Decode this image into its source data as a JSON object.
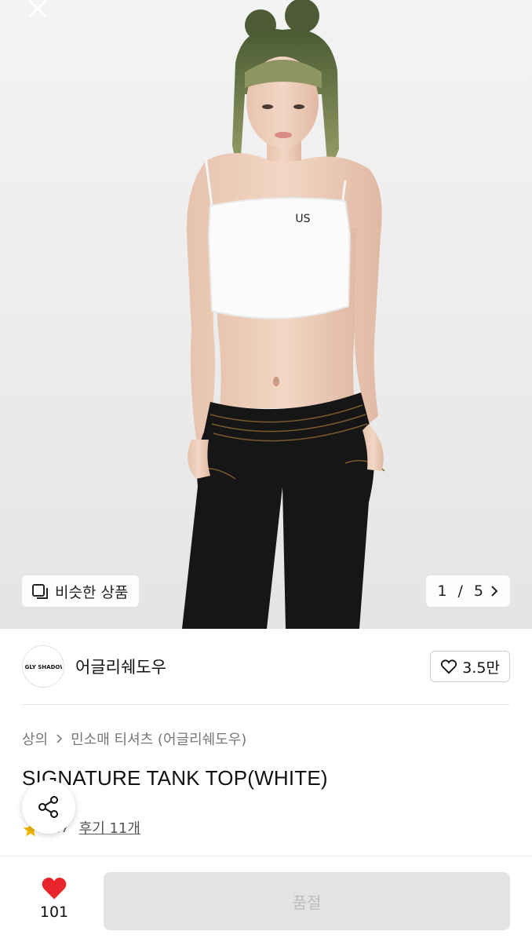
{
  "hero": {
    "similar_label": "비슷한 상품",
    "page_current": "1",
    "page_total": "5",
    "page_sep": " / ",
    "top_logo_text": "US"
  },
  "brand": {
    "name": "어글리쉐도우",
    "logo_text": "UGLY SHADOW",
    "likes": "3.5만"
  },
  "breadcrumb": {
    "level1": "상의",
    "level2": "민소매 티셔츠 (어글리쉐도우)"
  },
  "product": {
    "title": "SIGNATURE TANK TOP(WHITE)",
    "rating": "4.7",
    "reviews": "후기 11개"
  },
  "bottom": {
    "wish_count": "101",
    "soldout_label": "품절"
  },
  "colors": {
    "heart": "#e8252b",
    "star": "#f2b705",
    "soldout_bg": "#e3e3e3",
    "soldout_text": "#bdbdbd"
  }
}
